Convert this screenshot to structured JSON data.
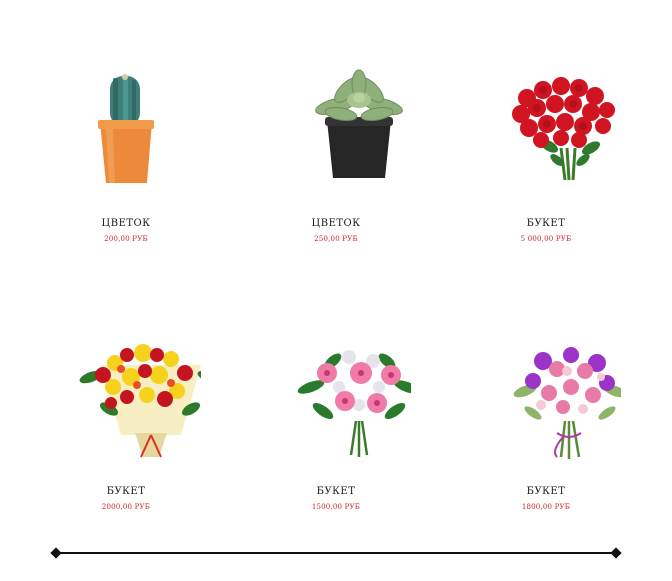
{
  "products": [
    {
      "name": "ЦВЕТОК",
      "price": "200,00 РУБ",
      "image": "cactus-pot-image"
    },
    {
      "name": "ЦВЕТОК",
      "price": "250,00 РУБ",
      "image": "succulent-pot-image"
    },
    {
      "name": "БУКЕТ",
      "price": "5 000,00 РУБ",
      "image": "red-roses-bouquet-image"
    },
    {
      "name": "БУКЕТ",
      "price": "2000,00 РУБ",
      "image": "mixed-yellow-red-bouquet-image"
    },
    {
      "name": "БУКЕТ",
      "price": "1500,00 РУБ",
      "image": "pink-gerbera-bouquet-image"
    },
    {
      "name": "БУКЕТ",
      "price": "1800,00 РУБ",
      "image": "purple-orchid-bouquet-image"
    }
  ],
  "colors": {
    "price": "#d21f26",
    "text": "#1a1a1a",
    "divider": "#111111"
  }
}
